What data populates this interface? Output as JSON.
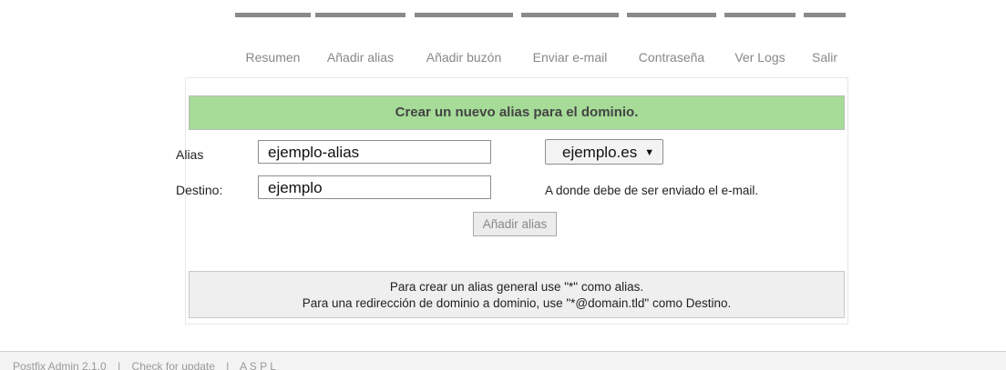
{
  "nav": {
    "tabs": [
      {
        "label": "Resumen"
      },
      {
        "label": "Añadir alias"
      },
      {
        "label": "Añadir buzón"
      },
      {
        "label": "Enviar e-mail"
      },
      {
        "label": "Contraseña"
      },
      {
        "label": "Ver Logs"
      },
      {
        "label": "Salir"
      }
    ]
  },
  "form": {
    "title": "Crear un nuevo alias para el dominio.",
    "alias_label": "Alias",
    "alias_value": "ejemplo-alias",
    "domain_selected": "ejemplo.es",
    "destination_label": "Destino:",
    "destination_value": "ejemplo",
    "destination_hint": "A donde debe de ser enviado el e-mail.",
    "submit_label": "Añadir alias",
    "help_line1": "Para crear un alias general use \"*\" como alias.",
    "help_line2": "Para una redirección de dominio a dominio, use \"*@domain.tld\" como Destino."
  },
  "footer": {
    "version": "Postfix Admin 2.1.0",
    "sep1": "|",
    "update_link": "Check for update",
    "sep2": "|",
    "credits": "A S P L"
  },
  "colors": {
    "header_bg": "#a6dc98",
    "tab_border": "#8a8a8a"
  }
}
